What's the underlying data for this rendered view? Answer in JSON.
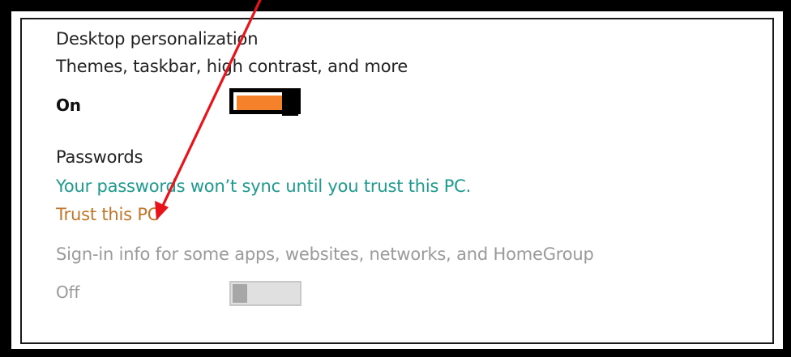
{
  "desktop_personalization": {
    "title": "Desktop personalization",
    "description": "Themes, taskbar, high contrast, and more",
    "state": "On"
  },
  "passwords": {
    "title": "Passwords",
    "warning": "Your passwords won’t sync until you trust this PC.",
    "trust_link": "Trust this PC",
    "signin_description": "Sign-in info for some apps, websites, networks, and HomeGroup",
    "state": "Off"
  },
  "colors": {
    "toggle_on": "#f5812a",
    "warning_text": "#1e9a8e",
    "link_text": "#c0762a",
    "disabled_text": "#9a9a9a",
    "annotation_arrow": "#e8141b"
  },
  "annotation": {
    "icon": "red-arrow-icon"
  }
}
